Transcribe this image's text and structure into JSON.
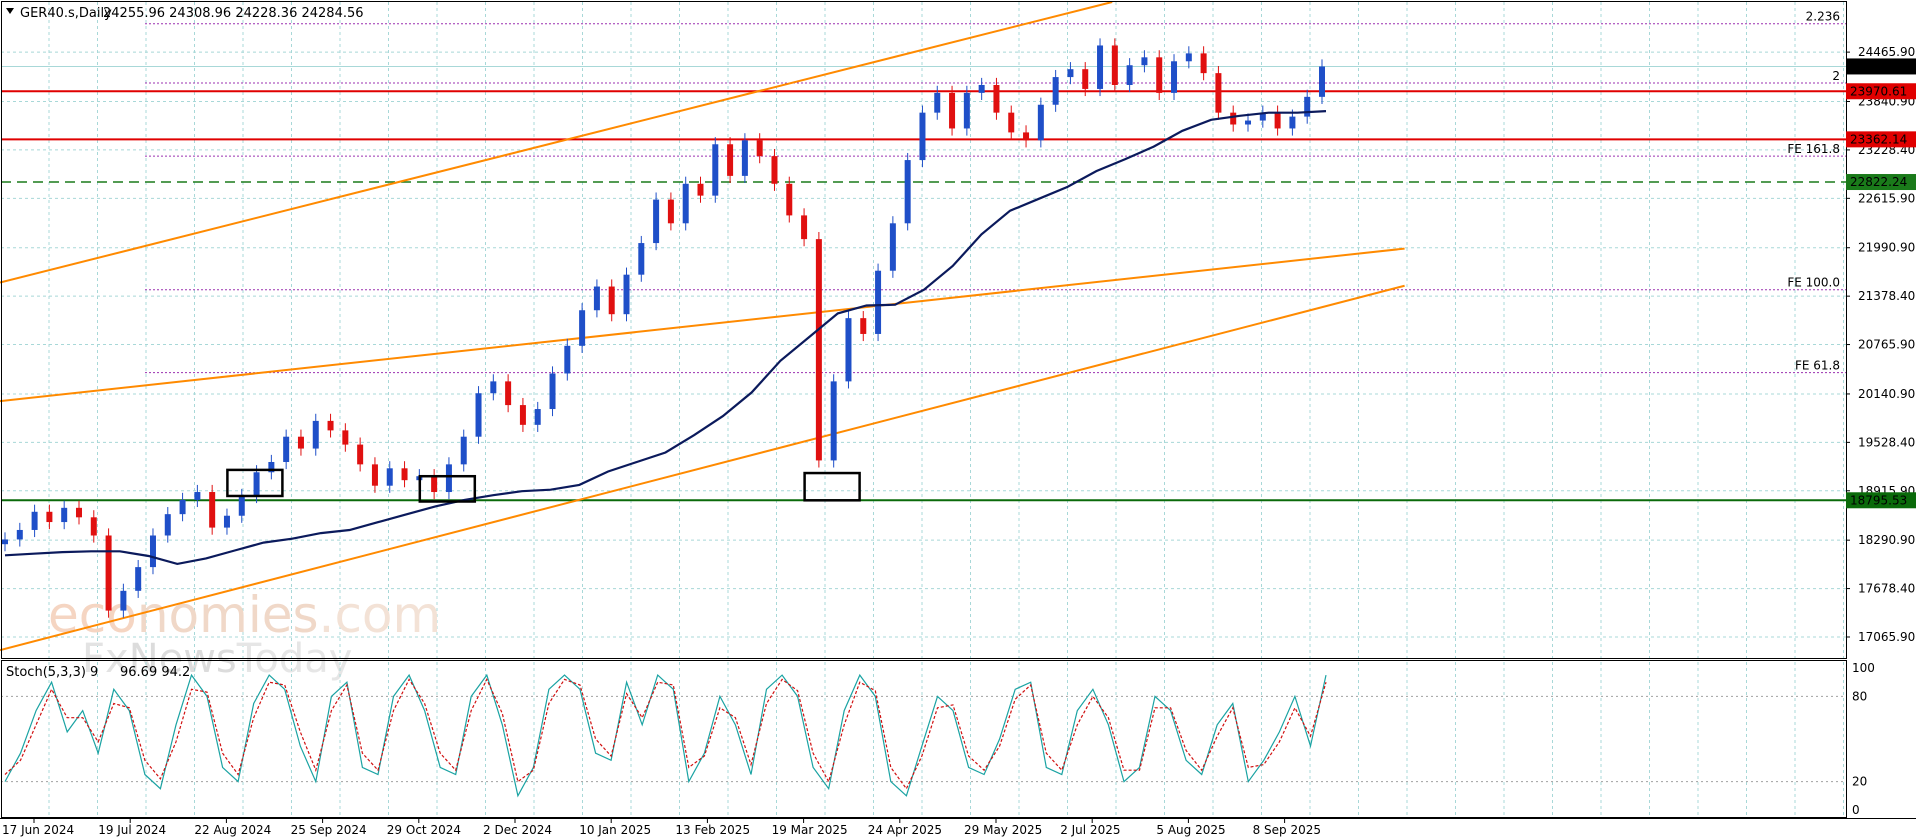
{
  "chart_data": [
    {
      "type": "candlestick",
      "symbol_label": "GER40.s,Daily",
      "ohlc_text": "24255.96 24308.96 24228.36 24284.56",
      "last_price": "24284.56",
      "ylim": [
        16800,
        25100
      ],
      "y_ticks": [
        "24465.90",
        "23840.90",
        "23228.40",
        "22615.90",
        "21990.90",
        "21378.40",
        "20765.90",
        "20140.90",
        "19528.40",
        "18915.90",
        "18290.90",
        "17678.40",
        "17065.90"
      ],
      "x_ticks": [
        "17 Jun 2024",
        "19 Jul 2024",
        "22 Aug 2024",
        "25 Sep 2024",
        "29 Oct 2024",
        "2 Dec 2024",
        "10 Jan 2025",
        "13 Feb 2025",
        "19 Mar 2025",
        "24 Apr 2025",
        "29 May 2025",
        "2 Jul 2025",
        "5 Aug 2025",
        "8 Sep 2025"
      ],
      "price_path": [
        18300,
        18420,
        18650,
        18520,
        18700,
        18580,
        18350,
        17400,
        17650,
        17950,
        18350,
        18620,
        18800,
        18900,
        18450,
        18600,
        18850,
        19150,
        19280,
        19600,
        19450,
        19800,
        19680,
        19500,
        19250,
        18980,
        19200,
        19050,
        19100,
        18900,
        19250,
        19600,
        20150,
        20300,
        20000,
        19750,
        19950,
        20400,
        20750,
        21200,
        21500,
        21150,
        21650,
        22050,
        22600,
        22300,
        22800,
        22650,
        23300,
        22900,
        23350,
        23150,
        22800,
        22400,
        22100,
        19300,
        20300,
        21100,
        20900,
        21700,
        22300,
        23100,
        23700,
        23950,
        23500,
        23950,
        24050,
        23700,
        23450,
        23350,
        23800,
        24150,
        24250,
        24000,
        24550,
        24050,
        24300,
        24400,
        23950,
        24350,
        24450,
        24200,
        23700,
        23550,
        23600,
        23700,
        23500,
        23650,
        23900,
        24284
      ],
      "moving_average": {
        "name": "",
        "color": "#0b1a5c",
        "path": [
          18100,
          18120,
          18140,
          18150,
          18150,
          18090,
          17990,
          18060,
          18160,
          18260,
          18310,
          18380,
          18420,
          18520,
          18620,
          18720,
          18800,
          18860,
          18910,
          18930,
          18990,
          19160,
          19280,
          19400,
          19620,
          19860,
          20160,
          20560,
          20860,
          21160,
          21260,
          21270,
          21460,
          21760,
          22160,
          22460,
          22610,
          22760,
          22960,
          23110,
          23270,
          23470,
          23610,
          23660,
          23700,
          23700,
          23720
        ]
      },
      "horizontal_levels": [
        {
          "value": 23970.61,
          "label": "23970.61",
          "color": "#e00000",
          "style": "solid"
        },
        {
          "value": 23362.14,
          "label": "23362.14",
          "color": "#e00000",
          "style": "solid"
        },
        {
          "value": 22822.24,
          "label": "22822.24",
          "color": "#1a7a1a",
          "style": "dashed"
        },
        {
          "value": 18795.53,
          "label": "18795.53",
          "color": "#0a6a0a",
          "style": "solid"
        }
      ],
      "fib_levels": [
        {
          "value": 24825,
          "label": "2.236"
        },
        {
          "value": 24075,
          "label": "2"
        },
        {
          "value": 23150,
          "label": "FE 161.8"
        },
        {
          "value": 21460,
          "label": "FE 100.0"
        },
        {
          "value": 20410,
          "label": "FE 61.8"
        }
      ],
      "channel_lines": [
        {
          "from": [
            "17 Jun 2024",
            21550
          ],
          "to": [
            "2 Jul 2025",
            25100
          ]
        },
        {
          "from": [
            "17 Jun 2024",
            20050
          ],
          "to": [
            "8 Sep 2025",
            21980
          ]
        },
        {
          "from": [
            "17 Jun 2024",
            16900
          ],
          "to": [
            "8 Sep 2025",
            21510
          ]
        }
      ],
      "highlight_boxes": [
        {
          "from": "22 Aug 2024",
          "low": 18850,
          "high": 19180
        },
        {
          "from": "29 Oct 2024",
          "low": 18780,
          "high": 19100
        },
        {
          "from": "19 Mar 2025",
          "low": 18795,
          "high": 19140
        }
      ],
      "watermark": {
        "line1_a": "eco",
        "line1_b": "nomies",
        "line1_c": ".com",
        "line2_a": "Fx",
        "line2_b": "News",
        "line2_c": "Today"
      }
    },
    {
      "type": "line",
      "indicator_label": "Stoch(5,3,3) 9",
      "indicator_values": "96.69 94.2",
      "ylim": [
        0,
        100
      ],
      "y_ticks": [
        "100",
        "80",
        "20",
        "0"
      ],
      "series": [
        {
          "name": "",
          "color": "#1aa3a3",
          "values": [
            20,
            40,
            70,
            90,
            55,
            70,
            40,
            85,
            70,
            25,
            15,
            60,
            95,
            80,
            30,
            20,
            75,
            95,
            85,
            45,
            20,
            80,
            90,
            30,
            25,
            80,
            95,
            70,
            30,
            25,
            80,
            95,
            60,
            10,
            30,
            85,
            95,
            85,
            40,
            35,
            90,
            60,
            95,
            85,
            20,
            40,
            80,
            60,
            25,
            85,
            95,
            80,
            30,
            15,
            70,
            95,
            80,
            20,
            10,
            45,
            80,
            70,
            30,
            25,
            50,
            85,
            90,
            30,
            25,
            70,
            85,
            60,
            20,
            30,
            80,
            70,
            35,
            25,
            60,
            75,
            20,
            35,
            55,
            80,
            45,
            95
          ]
        },
        {
          "name": "",
          "color": "#d01010",
          "style": "dashed",
          "values": [
            25,
            35,
            60,
            85,
            65,
            65,
            48,
            75,
            72,
            35,
            22,
            48,
            85,
            83,
            40,
            25,
            65,
            90,
            88,
            55,
            28,
            70,
            88,
            40,
            28,
            70,
            92,
            75,
            40,
            28,
            70,
            92,
            68,
            20,
            28,
            75,
            92,
            88,
            50,
            38,
            82,
            65,
            90,
            88,
            30,
            38,
            72,
            65,
            32,
            75,
            92,
            84,
            40,
            20,
            60,
            90,
            84,
            30,
            15,
            38,
            72,
            74,
            38,
            28,
            45,
            78,
            88,
            40,
            28,
            60,
            80,
            65,
            28,
            28,
            72,
            72,
            42,
            28,
            52,
            72,
            30,
            32,
            48,
            72,
            52,
            90
          ]
        }
      ]
    }
  ]
}
